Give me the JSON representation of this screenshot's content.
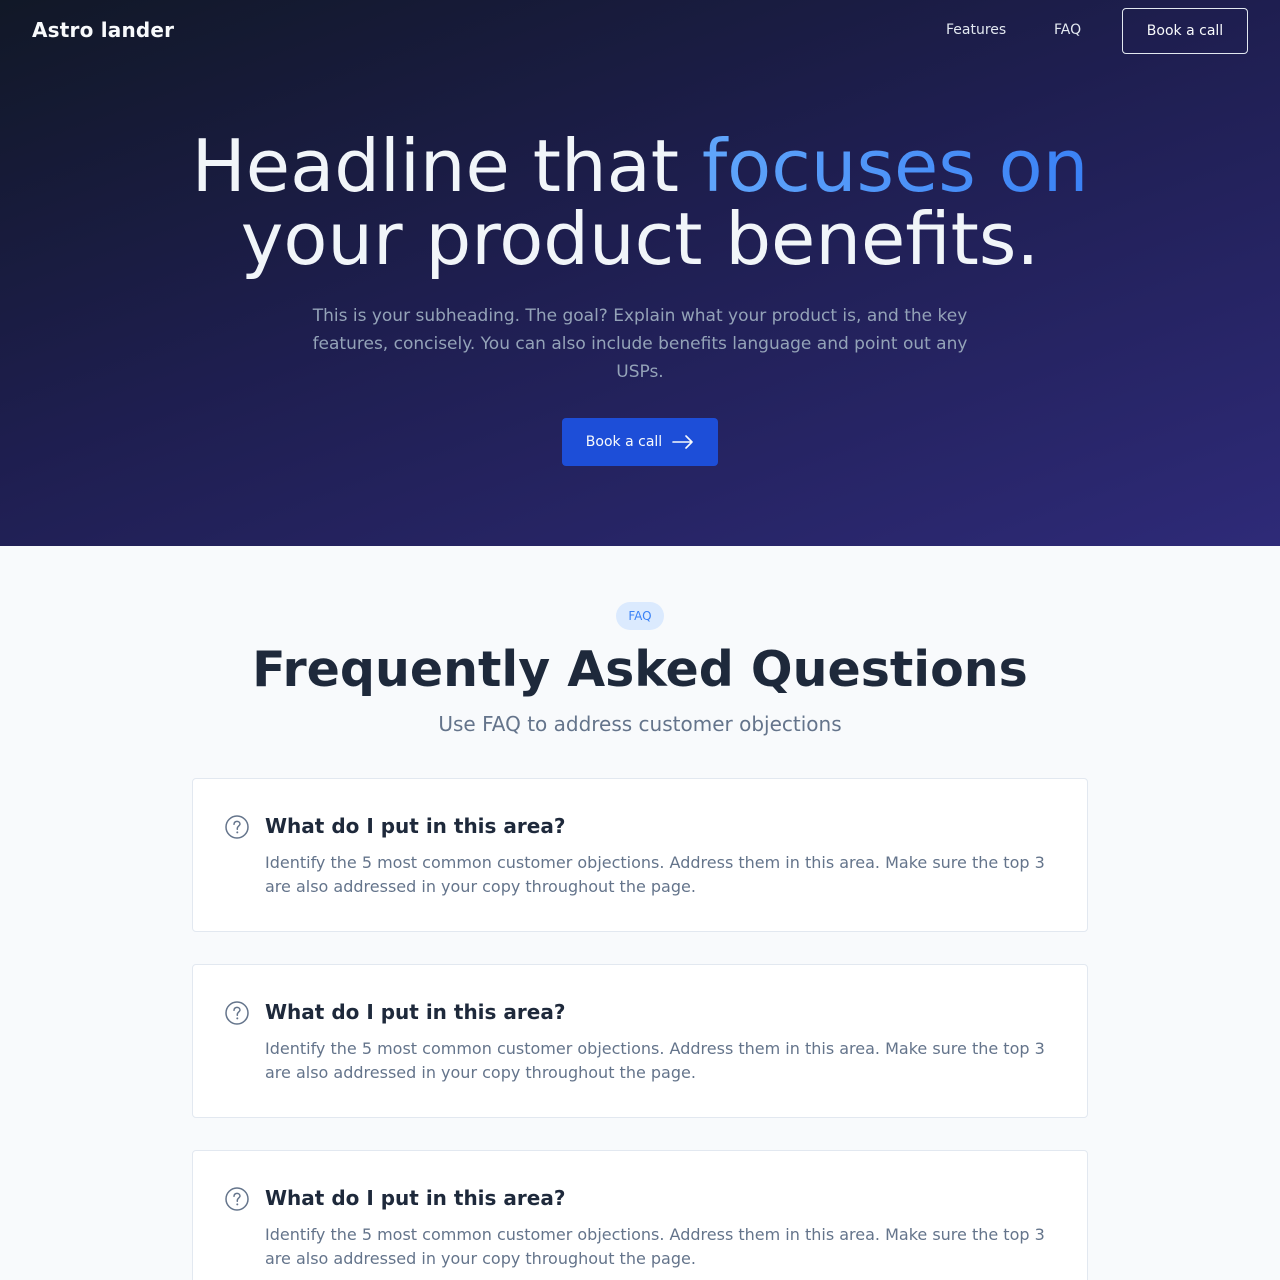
{
  "nav": {
    "brand": "Astro lander",
    "links": [
      "Features",
      "FAQ"
    ],
    "cta": "Book a call"
  },
  "hero": {
    "headline_part1": "Headline that ",
    "headline_accent": "focuses on",
    "headline_part2": "your product benefits.",
    "subheading": "This is your subheading. The goal? Explain what your product is, and the key features, concisely. You can also include benefits language and point out any USPs.",
    "cta": "Book a call",
    "cta_icon": "arrow-right-icon"
  },
  "faq": {
    "badge": "FAQ",
    "title": "Frequently Asked Questions",
    "subtitle": "Use FAQ to address customer objections",
    "items": [
      {
        "question": "What do I put in this area?",
        "answer": "Identify the 5 most common customer objections. Address them in this area. Make sure the top 3 are also addressed in your copy throughout the page."
      },
      {
        "question": "What do I put in this area?",
        "answer": "Identify the 5 most common customer objections. Address them in this area. Make sure the top 3 are also addressed in your copy throughout the page."
      },
      {
        "question": "What do I put in this area?",
        "answer": "Identify the 5 most common customer objections. Address them in this area. Make sure the top 3 are also addressed in your copy throughout the page."
      }
    ]
  },
  "colors": {
    "hero_bg_start": "#111827",
    "hero_bg_end": "#2e2a78",
    "accent": "#3b82f6",
    "cta_bg": "#1d4ed8",
    "page_bg": "#f8fafc"
  }
}
